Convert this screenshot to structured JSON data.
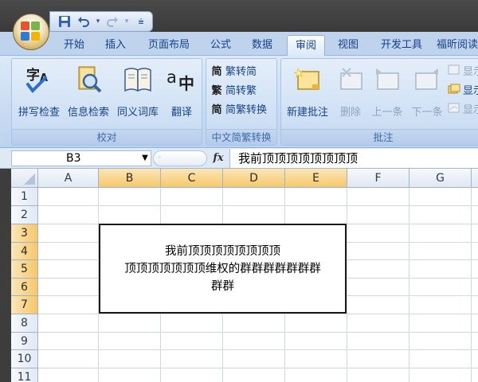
{
  "qat": {
    "icons": [
      "save-icon",
      "undo-icon",
      "redo-icon",
      "customize-icon"
    ]
  },
  "tabs": [
    {
      "label": "开始",
      "active": false
    },
    {
      "label": "插入",
      "active": false
    },
    {
      "label": "页面布局",
      "active": false
    },
    {
      "label": "公式",
      "active": false
    },
    {
      "label": "数据",
      "active": false
    },
    {
      "label": "审阅",
      "active": true
    },
    {
      "label": "视图",
      "active": false
    },
    {
      "label": "开发工具",
      "active": false
    },
    {
      "label": "福昕阅读",
      "active": false
    }
  ],
  "ribbon": {
    "proofing": {
      "label": "校对",
      "spelling": "拼写检查",
      "research": "信息检索",
      "thesaurus": "同义词库",
      "translate": "翻译"
    },
    "chinese_conversion": {
      "label": "中文简繁转换",
      "to_simplified": "繁转简",
      "to_traditional": "简转繁",
      "conversion": "简繁转换",
      "icon_glyphs": [
        "简",
        "繁",
        "简"
      ]
    },
    "comments": {
      "label": "批注",
      "new_comment": "新建批注",
      "delete": "删除",
      "previous": "上一条",
      "next": "下一条",
      "show_1": "显示",
      "show_2": "显示",
      "show_3": "显示"
    },
    "icon_text": {
      "spelling": "字",
      "translate": "a中"
    }
  },
  "formula_bar": {
    "name_box": "B3",
    "fx": "fx",
    "value": "我前顶顶顶顶顶顶顶顶"
  },
  "grid": {
    "columns": [
      "A",
      "B",
      "C",
      "D",
      "E",
      "F",
      "G"
    ],
    "selected_columns": [
      "B",
      "C",
      "D",
      "E"
    ],
    "rows": [
      "1",
      "2",
      "3",
      "4",
      "5",
      "6",
      "7",
      "8",
      "9",
      "10",
      "11"
    ],
    "selected_rows": [
      "3",
      "4",
      "5",
      "6",
      "7"
    ]
  },
  "merged_cell": {
    "line1": "我前顶顶顶顶顶顶顶顶",
    "line2": "顶顶顶顶顶顶顶维权的群群群群群群群",
    "line3": "群群"
  },
  "colors": {
    "accent": "#15428b",
    "ribbon_bg": "#c5d9f1",
    "selected_header": "#f7c86a"
  }
}
